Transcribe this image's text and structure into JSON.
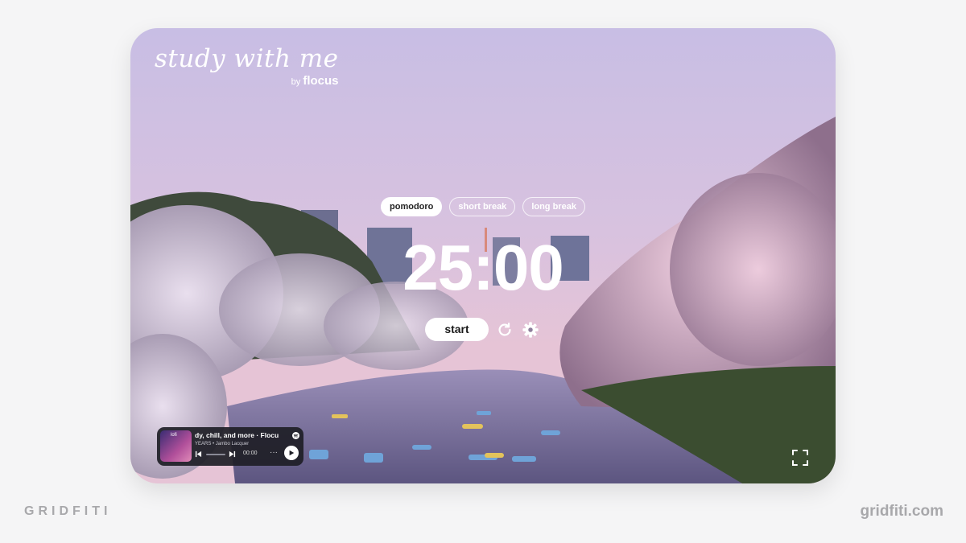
{
  "brand": {
    "title": "study with me",
    "by": "by",
    "name": "flocus"
  },
  "modes": [
    {
      "label": "pomodoro",
      "active": true
    },
    {
      "label": "short break",
      "active": false
    },
    {
      "label": "long break",
      "active": false
    }
  ],
  "timer": {
    "display": "25:00"
  },
  "controls": {
    "start_label": "start",
    "reset_icon": "reset-icon",
    "settings_icon": "gear-icon"
  },
  "player": {
    "album_label": "lofi",
    "track_title": "dy, chill, and more · Flocu",
    "track_artist": "YEARS • Jambo Lacquer",
    "time_elapsed": "00:00",
    "more": "···",
    "service_icon": "spotify-icon"
  },
  "fullscreen_icon": "fullscreen-icon",
  "watermarks": {
    "left": "GRIDFITI",
    "right": "gridfiti.com"
  },
  "colors": {
    "sky_top": "#c9bde3",
    "sky_bottom": "#e4c0d8",
    "accent_white": "#ffffff",
    "page_bg": "#f5f5f6"
  }
}
